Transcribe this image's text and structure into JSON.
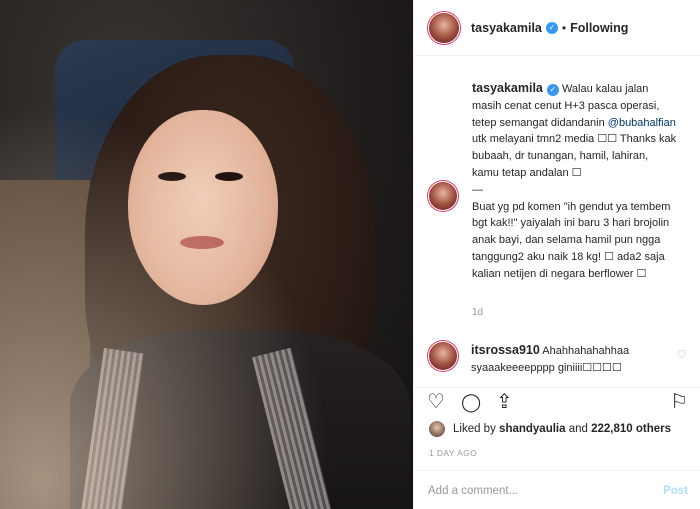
{
  "header": {
    "username": "tasyakamila",
    "verified_symbol": "✓",
    "separator": "•",
    "follow_status": "Following"
  },
  "caption": {
    "username": "tasyakamila",
    "text_part1": "Walau kalau jalan masih cenat cenut H+3 pasca operasi, tetep semangat didandanin",
    "mention": "@bubahalfian",
    "text_part2": "utk melayani tmn2 media ☐☐ Thanks kak bubaah, dr tunangan, hamil, lahiran, kamu tetap andalan ☐",
    "dash": "—",
    "text_part3": "Buat yg pd komen \"ih gendut ya tembem bgt kak!!\" yaiyalah ini baru 3 hari brojolin anak bayi, dan selama hamil pun ngga tanggung2 aku naik 18 kg! ☐ ada2 saja kalian netijen di negara berflower ☐",
    "time": "1d"
  },
  "comment": {
    "username": "itsrossa910",
    "text": "Ahahhahahahhaa syaaakeeeepppp giniiii☐☐☐☐"
  },
  "actions": {
    "like_icon": "♡",
    "comment_icon": "◯",
    "share_icon": "⇪",
    "save_icon": "⚐"
  },
  "likes": {
    "prefix": "Liked by",
    "user": "shandyaulia",
    "middle": "and",
    "count": "222,810 others"
  },
  "posted": "1 DAY AGO",
  "add_comment": {
    "placeholder": "Add a comment...",
    "post_label": "Post"
  },
  "colors": {
    "link": "#003569",
    "verified": "#3897f0",
    "post_button": "#b2dffc",
    "muted": "#999999"
  }
}
